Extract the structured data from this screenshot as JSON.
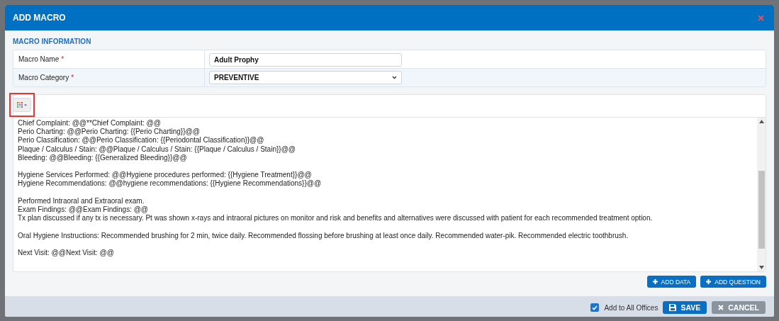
{
  "dialog": {
    "title": "ADD MACRO"
  },
  "section_title": "MACRO INFORMATION",
  "fields": [
    {
      "label": "Macro Name",
      "required_mark": "*",
      "kind": "text",
      "value": "Adult Prophy"
    },
    {
      "label": "Macro Category",
      "required_mark": "*",
      "kind": "select",
      "value": "PREVENTIVE"
    }
  ],
  "editor": {
    "paragraphs": [
      [
        "Chief Complaint: @@**Chief Complaint: @@",
        "Perio Charting: @@Perio Charting: {{Perio Charting}}@@",
        "Perio Classification: @@Perio Classification: {{Periodontal Classification}}@@",
        "Plaque / Calculus / Stain: @@Plaque / Calculus / Stain: {{Plaque / Calculus / Stain}}@@",
        "Bleeding: @@Bleeding: {{Generalized Bleeding}}@@"
      ],
      [
        "Hygiene Services Performed: @@Hygiene procedures performed: {{Hygiene Treatment}}@@",
        "Hygiene Recommendations: @@hygiene recommendations: {{Hygiene Recommendations}}@@"
      ],
      [
        "Performed Intraoral and Extraoral exam.",
        "Exam Findings: @@Exam Findings: @@",
        "Tx plan discussed if any tx is necessary.  Pt was shown x-rays and intraoral pictures on monitor and risk and benefits and alternatives were discussed with patient for each recommended treatment option."
      ],
      [
        "Oral Hygiene Instructions: Recommended brushing for 2 min, twice daily. Recommended flossing before brushing at least once daily. Recommended water-pik. Recommended electric toothbrush."
      ],
      [
        "Next Visit: @@Next Visit: @@"
      ]
    ]
  },
  "editor_buttons": [
    "ADD DATA",
    "ADD QUESTION"
  ],
  "footer": {
    "add_to_all_offices": {
      "label": "Add to All Offices",
      "checked": true
    },
    "buttons": [
      {
        "label": "SAVE",
        "kind": "primary"
      },
      {
        "label": "CANCEL",
        "kind": "secondary"
      }
    ]
  }
}
